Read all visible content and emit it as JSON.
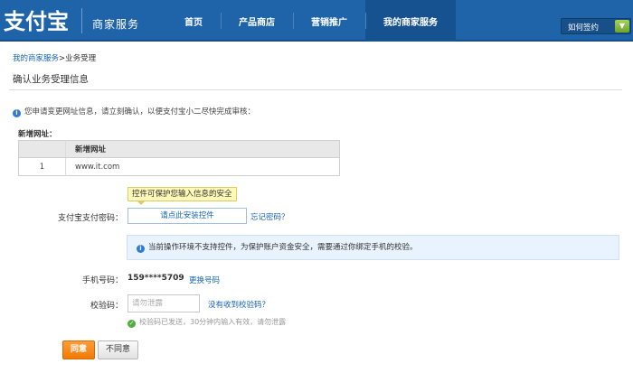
{
  "header": {
    "logo_text": "支付宝",
    "brand_sub": "商家服务",
    "nav": [
      "首页",
      "产品商店",
      "营销推广",
      "我的商家服务"
    ],
    "active_nav_index": 3,
    "help_label": "如何签约",
    "help_button_icon": "chevron-down-icon",
    "colors": {
      "header_bg": "#1f64a8",
      "accent_orange": "#f07a08",
      "link": "#1764b5"
    }
  },
  "breadcrumb": {
    "link": "我的商家服务",
    "separator": ">",
    "current": "业务受理"
  },
  "page_title": "确认业务受理信息",
  "notice": "您申请变更网址信息，请立刻确认，以便支付宝小二尽快完成审核：",
  "new_urls": {
    "label": "新增网址：",
    "columns": [
      "",
      "新增网址"
    ],
    "rows": [
      {
        "index": "1",
        "url": "www.it.com"
      }
    ]
  },
  "password": {
    "tooltip": "控件可保护您输入信息的安全",
    "label": "支付宝支付密码：",
    "install_link": "请点此安装控件",
    "forgot_link": "忘记密码？"
  },
  "tip_bar": "当前操作环境不支持控件，为保护账户资金安全，需要通过你绑定手机的校验。",
  "phone": {
    "label": "手机号码：",
    "value": "159****5709",
    "change_link": "更换号码"
  },
  "code": {
    "label": "校验码：",
    "placeholder": "请勿泄露",
    "not_received_link": "没有收到校验码？",
    "sent_tip": "校验码已发送，30分钟内输入有效，请勿泄露"
  },
  "buttons": {
    "agree": "同意",
    "disagree": "不同意"
  }
}
